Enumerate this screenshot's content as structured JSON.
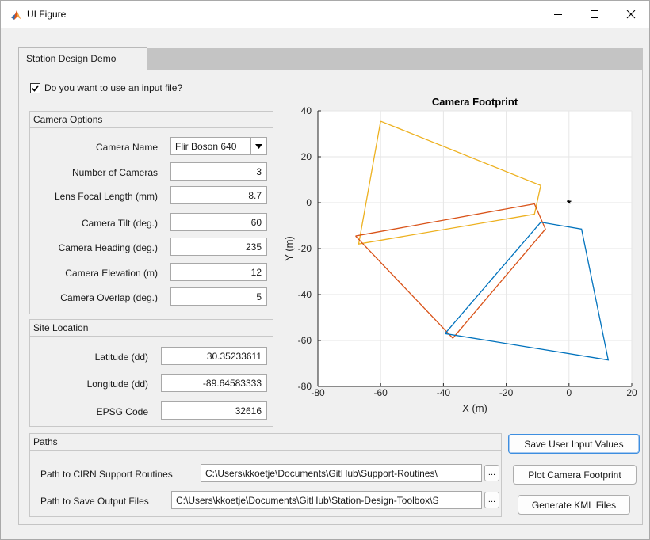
{
  "window": {
    "title": "UI Figure",
    "controls": {
      "minimize": "minimize-icon",
      "maximize": "maximize-icon",
      "close": "close-icon"
    }
  },
  "tabs": [
    {
      "label": "Station Design Demo"
    }
  ],
  "input_file_checkbox": {
    "label": "Do you want to use an input file?",
    "checked": true
  },
  "camera_options": {
    "title": "Camera Options",
    "camera_name": {
      "label": "Camera Name",
      "value": "Flir Boson 640"
    },
    "num_cameras": {
      "label": "Number of Cameras",
      "value": "3"
    },
    "focal_length": {
      "label": "Lens Focal Length (mm)",
      "value": "8.7"
    },
    "tilt": {
      "label": "Camera Tilt (deg.)",
      "value": "60"
    },
    "heading": {
      "label": "Camera Heading (deg.)",
      "value": "235"
    },
    "elevation": {
      "label": "Camera Elevation (m)",
      "value": "12"
    },
    "overlap": {
      "label": "Camera Overlap (deg.)",
      "value": "5"
    }
  },
  "site_location": {
    "title": "Site Location",
    "latitude": {
      "label": "Latitude (dd)",
      "value": "30.35233611"
    },
    "longitude": {
      "label": "Longitude (dd)",
      "value": "-89.64583333"
    },
    "epsg": {
      "label": "EPSG Code",
      "value": "32616"
    }
  },
  "paths": {
    "title": "Paths",
    "cirn": {
      "label": "Path to CIRN Support Routines",
      "value": "C:\\Users\\kkoetje\\Documents\\GitHub\\Support-Routines\\",
      "browse": "..."
    },
    "output": {
      "label": "Path to Save Output Files",
      "value": "C:\\Users\\kkoetje\\Documents\\GitHub\\Station-Design-Toolbox\\S",
      "browse": "..."
    }
  },
  "buttons": {
    "save": "Save User Input Values",
    "plot": "Plot Camera Footprint",
    "kml": "Generate KML Files"
  },
  "chart_data": {
    "type": "line",
    "title": "Camera Footprint",
    "xlabel": "X (m)",
    "ylabel": "Y (m)",
    "xlim": [
      -80,
      20
    ],
    "ylim": [
      -80,
      40
    ],
    "xticks": [
      -80,
      -60,
      -40,
      -20,
      0,
      20
    ],
    "yticks": [
      -80,
      -60,
      -40,
      -20,
      0,
      20,
      40
    ],
    "grid": true,
    "series": [
      {
        "color": "#edb120",
        "points": [
          [
            -60,
            35.5
          ],
          [
            -9,
            7.5
          ],
          [
            -11,
            -5
          ],
          [
            -67,
            -18
          ],
          [
            -60,
            35.5
          ]
        ]
      },
      {
        "color": "#d95319",
        "points": [
          [
            -68,
            -14.5
          ],
          [
            -11,
            -0.5
          ],
          [
            -7.5,
            -11.5
          ],
          [
            -37,
            -59
          ],
          [
            -68,
            -14.5
          ]
        ]
      },
      {
        "color": "#0072bd",
        "points": [
          [
            -39.5,
            -57
          ],
          [
            -9,
            -8.5
          ],
          [
            4,
            -11.5
          ],
          [
            12.5,
            -68.5
          ],
          [
            -39.5,
            -57
          ]
        ]
      }
    ],
    "markers": [
      {
        "x": 0,
        "y": 0,
        "symbol": "*"
      }
    ]
  }
}
